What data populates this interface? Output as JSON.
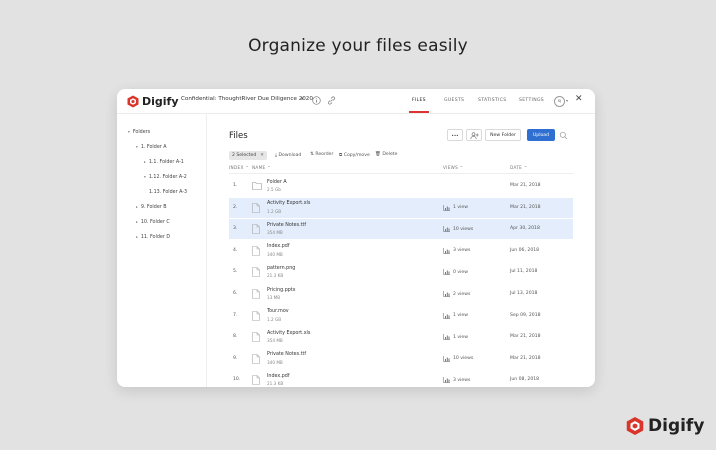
{
  "headline": "Organize your files easily",
  "brand": {
    "name": "Digify",
    "accent_color": "#d9352b",
    "icon": "digify-logo-icon"
  },
  "topbar": {
    "document_title": "Confidential: ThoughtRiver Due Diligence 2020",
    "caret": "▾",
    "nav": {
      "files": "FILES",
      "guests": "GUESTS",
      "statistics": "STATISTICS",
      "settings": "SETTINGS"
    },
    "active_tab": "files",
    "avatar": "SJ",
    "avatar_caret": "▾",
    "close": "✕"
  },
  "sidebar": {
    "root": "Folders",
    "items": [
      {
        "label": "1.  Folder A",
        "caret": "▾"
      },
      {
        "label": "1.1.  Folder A-1",
        "caret": "▸"
      },
      {
        "label": "1.12.  Folder A-2",
        "caret": "▾"
      },
      {
        "label": "1.13.  Folder A-3",
        "caret": ""
      },
      {
        "label": "9.  Folder B",
        "caret": "▸"
      },
      {
        "label": "10.  Folder C",
        "caret": "▸"
      },
      {
        "label": "11.  Folder D",
        "caret": "▸"
      }
    ]
  },
  "main": {
    "title": "Files",
    "buttons": {
      "more": "•••",
      "new_folder": "New Folder",
      "upload": "Upload"
    },
    "toolbar": {
      "selected": "2 Selected",
      "clear": "✕",
      "download": "Download",
      "reorder": "Reorder",
      "copy_move": "Copy/move",
      "delete": "Delete"
    },
    "columns": {
      "index": "INDEX ⌃",
      "name": "NAME ⌃",
      "views": "VIEWS ⌃",
      "date": "DATE ⌃"
    },
    "rows": [
      {
        "index": "1.",
        "name": "Folder A",
        "size": "2.5 Gb",
        "views": "",
        "date": "Mar 21, 2018",
        "selected": false,
        "kind": "folder"
      },
      {
        "index": "2.",
        "name": "Activity Export.xls",
        "size": "1.2 GB",
        "views": "1 view",
        "date": "Mar 21, 2018",
        "selected": true,
        "kind": "file"
      },
      {
        "index": "3.",
        "name": "Private Notes.ttf",
        "size": "354 MB",
        "views": "10 views",
        "date": "Apr 30, 2018",
        "selected": true,
        "kind": "file"
      },
      {
        "index": "4.",
        "name": "Index.pdf",
        "size": "340 MB",
        "views": "3 views",
        "date": "Jun 06, 2018",
        "selected": false,
        "kind": "file"
      },
      {
        "index": "5.",
        "name": "pattern.png",
        "size": "21.3 KB",
        "views": "0 view",
        "date": "Jul 11, 2018",
        "selected": false,
        "kind": "file"
      },
      {
        "index": "6.",
        "name": "Pricing.pptx",
        "size": "13 MB",
        "views": "2 views",
        "date": "Jul 13, 2018",
        "selected": false,
        "kind": "file"
      },
      {
        "index": "7.",
        "name": "Tour.mov",
        "size": "1.2 GB",
        "views": "1 view",
        "date": "Sep 09, 2018",
        "selected": false,
        "kind": "file"
      },
      {
        "index": "8.",
        "name": "Activity Export.xls",
        "size": "354 MB",
        "views": "1 view",
        "date": "Mar 21, 2018",
        "selected": false,
        "kind": "file"
      },
      {
        "index": "9.",
        "name": "Private Notes.ttf",
        "size": "340 MB",
        "views": "10 views",
        "date": "Mar 21, 2018",
        "selected": false,
        "kind": "file"
      },
      {
        "index": "10.",
        "name": "Index.pdf",
        "size": "21.3 KB",
        "views": "3 views",
        "date": "Jun 08, 2018",
        "selected": false,
        "kind": "file"
      }
    ]
  }
}
